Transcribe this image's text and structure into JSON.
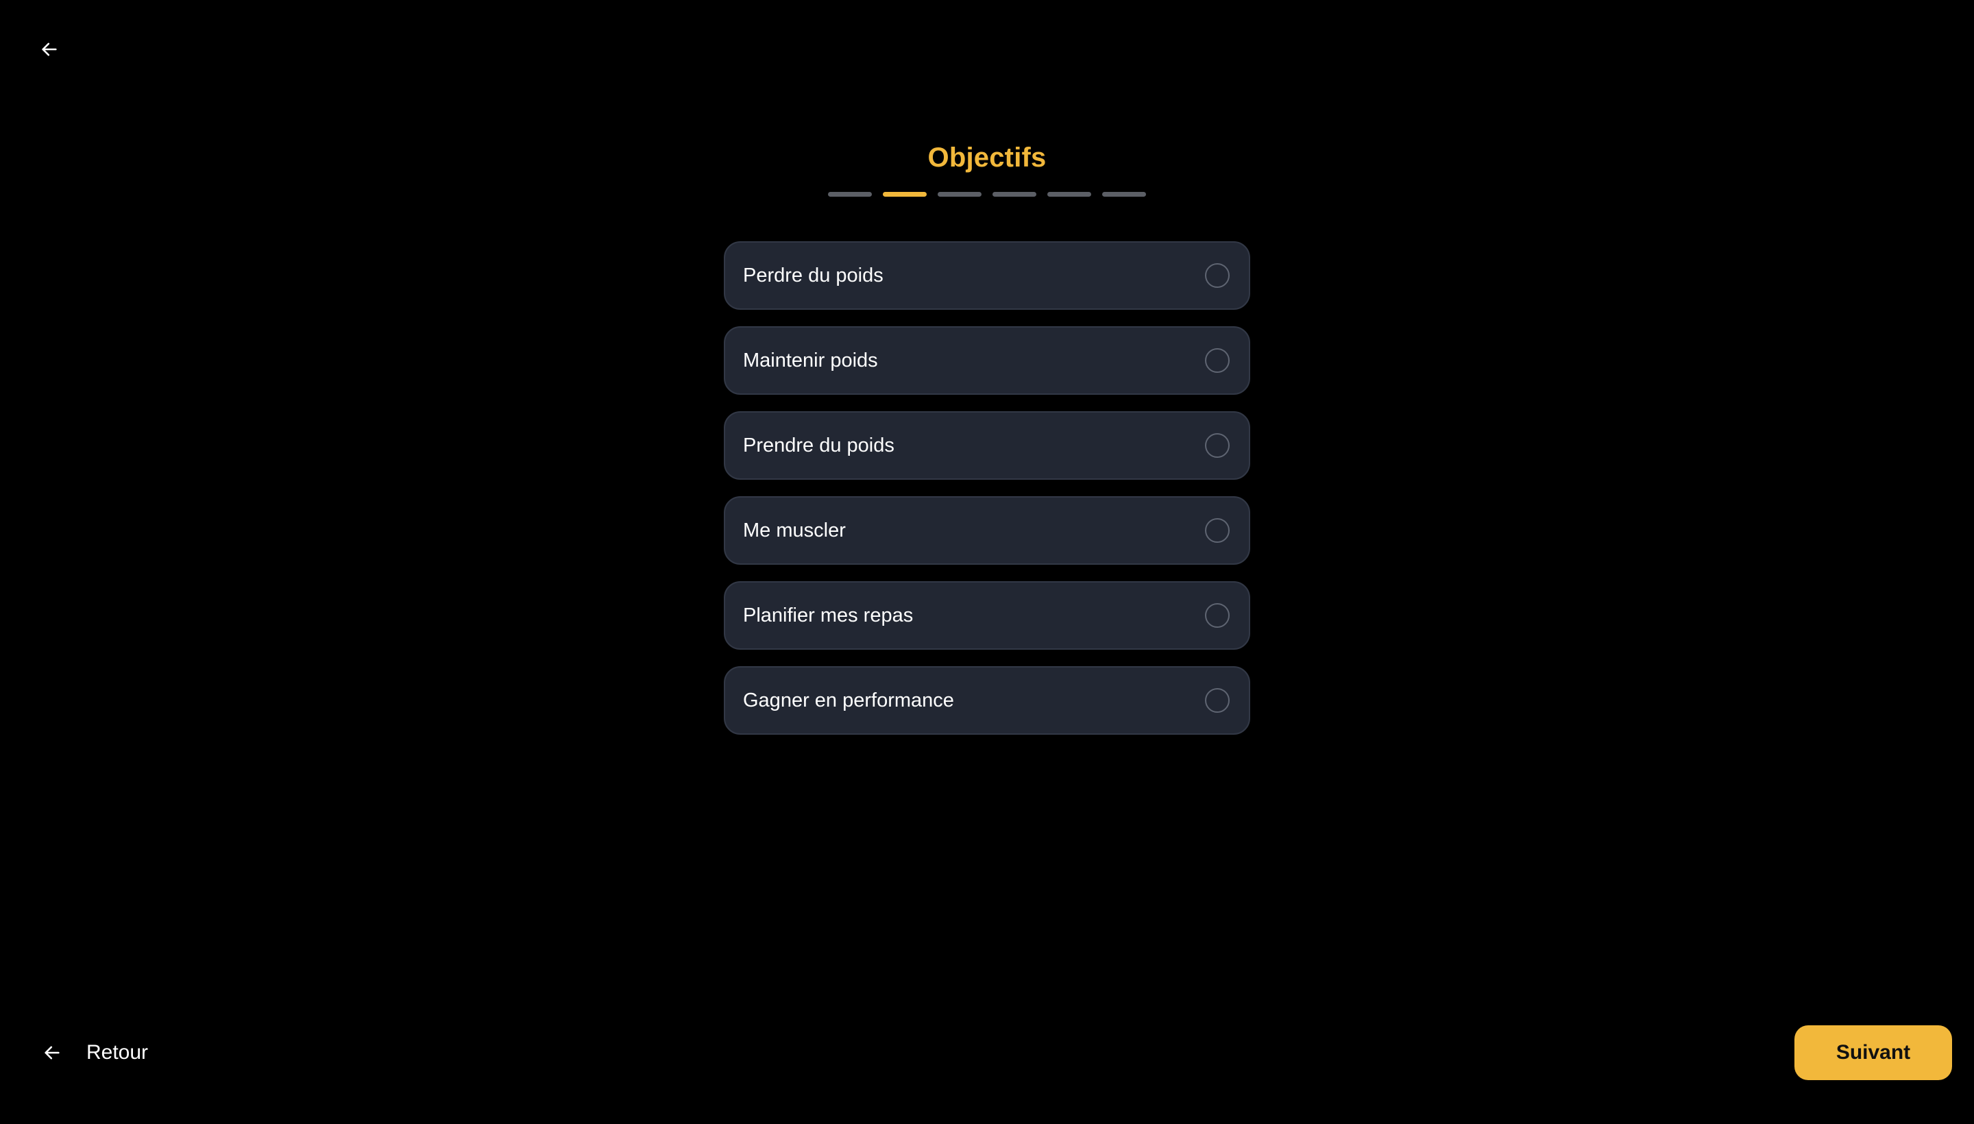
{
  "header": {
    "back_icon": "arrow-left-icon",
    "title": "Objectifs"
  },
  "progress": {
    "total_steps": 6,
    "current_step": 2
  },
  "options": [
    {
      "label": "Perdre du poids",
      "selected": false
    },
    {
      "label": "Maintenir poids",
      "selected": false
    },
    {
      "label": "Prendre du poids",
      "selected": false
    },
    {
      "label": "Me muscler",
      "selected": false
    },
    {
      "label": "Planifier mes repas",
      "selected": false
    },
    {
      "label": "Gagner en performance",
      "selected": false
    }
  ],
  "footer": {
    "back_label": "Retour",
    "next_label": "Suivant"
  },
  "colors": {
    "background": "#000000",
    "accent": "#f2b83b",
    "card": "#222733",
    "card_border": "#323846",
    "progress_inactive": "#5c5f66"
  }
}
